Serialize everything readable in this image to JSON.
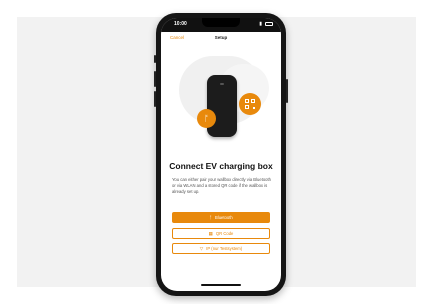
{
  "statusbar": {
    "time": "10:00"
  },
  "nav": {
    "cancel": "Cancel",
    "title": "Setup"
  },
  "heading": "Connect EV charging box",
  "description": "You can either pair your wallbox directly via Bluetooth or via WLAN and a stored QR code if the wallbox is already set up.",
  "buttons": {
    "bluetooth": "Bluetooth",
    "qr": "QR Code",
    "ip": "IP (nur Testsystem)"
  },
  "icons": {
    "bluetooth": "bluetooth-icon",
    "qr": "qr-code-icon",
    "ip": "filter-icon"
  },
  "colors": {
    "accent": "#e8890c"
  }
}
